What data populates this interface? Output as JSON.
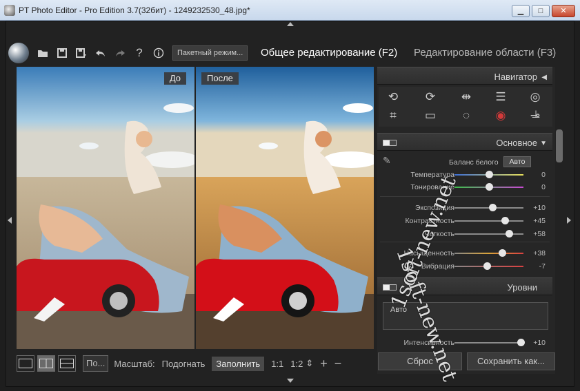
{
  "window": {
    "title": "PT Photo Editor - Pro Edition 3.7(32бит) - 1249232530_48.jpg*",
    "minimize": "▁",
    "maximize": "□",
    "close": "✕"
  },
  "toolbar": {
    "icons": [
      "open-folder-icon",
      "save-icon",
      "save-as-icon",
      "undo-icon",
      "redo-icon",
      "help-icon",
      "info-icon"
    ],
    "batch_label": "Пакетный режим...",
    "mode_tabs": [
      {
        "label": "Общее редактирование (F2)",
        "active": true
      },
      {
        "label": "Редактирование области (F3)",
        "active": false
      }
    ]
  },
  "preview": {
    "before_label": "До",
    "after_label": "После"
  },
  "bottombar": {
    "po_label": "По...",
    "scale_label": "Масштаб:",
    "fit_label": "Подогнать",
    "fill_label": "Заполнить",
    "one_to_one": "1:1",
    "one_to_two": "1:2",
    "spin": "⇕",
    "plus": "+",
    "minus": "−"
  },
  "panel": {
    "navigator_label": "Навигатор",
    "basic_label": "Основное",
    "white_balance_label": "Баланс белого",
    "white_balance_value": "Авто",
    "sliders": [
      {
        "label": "Температура",
        "value": "0",
        "level": 0.5
      },
      {
        "label": "Тонирование",
        "value": "0",
        "level": 0.5
      },
      {
        "label": "Экспозиция",
        "value": "+10",
        "level": 0.55
      },
      {
        "label": "Контрастность",
        "value": "+45",
        "level": 0.73
      },
      {
        "label": "Четкость",
        "value": "+58",
        "level": 0.79
      },
      {
        "label": "Насыщенность",
        "value": "+38",
        "level": 0.69
      },
      {
        "label": "Вибрация",
        "value": "-7",
        "level": 0.47
      }
    ],
    "levels_label": "Уровни",
    "levels_auto": "Авто",
    "intensity_label": "Интенсивность",
    "intensity_value": "+10",
    "intensity_level": 0.96,
    "reset_label": "Сброс",
    "save_as_label": "Сохранить как..."
  },
  "watermark": {
    "line1": "1soft-new.net",
    "line2": "1soft-new.net"
  },
  "colors": {
    "background": "#222222",
    "panel": "#262626",
    "sky_top": "#2d74b0",
    "car_red": "#c8161e"
  }
}
